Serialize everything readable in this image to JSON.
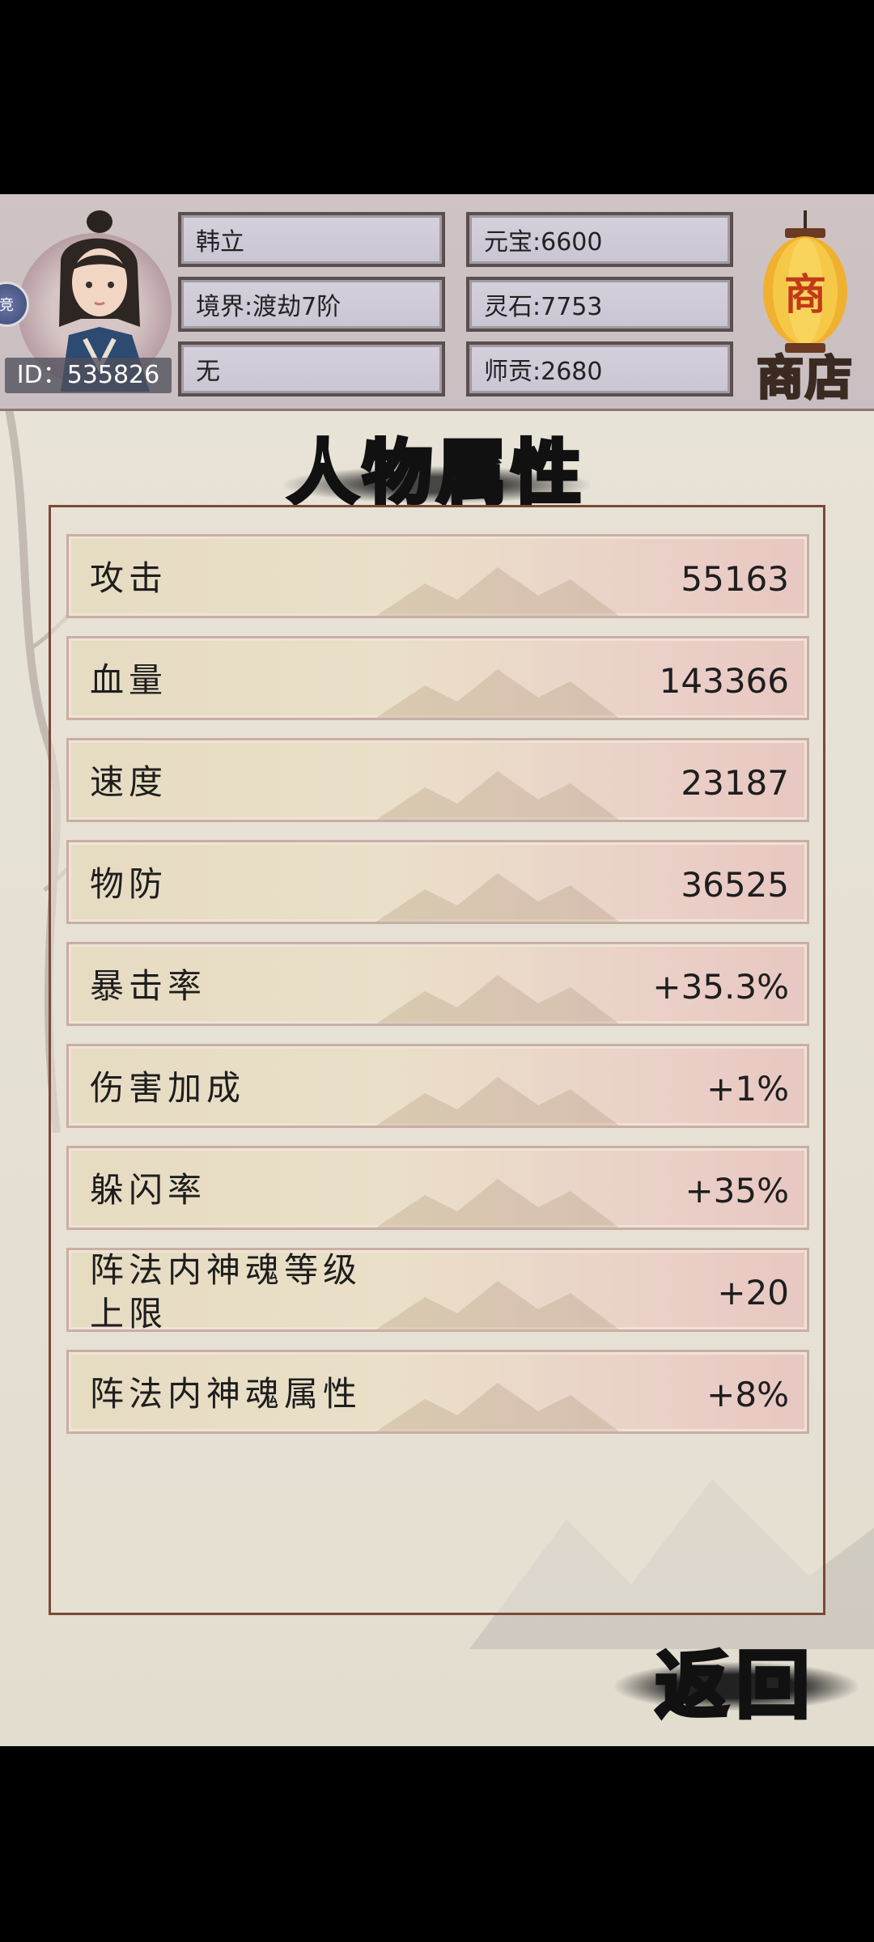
{
  "header": {
    "player_id": "ID：535826",
    "name": "韩立",
    "realm": "境界:渡劫7阶",
    "sect": "无",
    "yuanbao": "元宝:6600",
    "lingshi": "灵石:7753",
    "shigong": "师贡:2680",
    "shop_label": "商店",
    "lantern_char": "商",
    "side_orb_char": "竞"
  },
  "page_title": "人物属性",
  "stats": [
    {
      "label": "攻击",
      "value": "55163"
    },
    {
      "label": "血量",
      "value": "143366"
    },
    {
      "label": "速度",
      "value": "23187"
    },
    {
      "label": "物防",
      "value": "36525"
    },
    {
      "label": "暴击率",
      "value": "+35.3%"
    },
    {
      "label": "伤害加成",
      "value": "+1%"
    },
    {
      "label": "躲闪率",
      "value": "+35%"
    },
    {
      "label": "阵法内神魂等级上限",
      "value": "+20"
    },
    {
      "label": "阵法内神魂属性",
      "value": "+8%"
    }
  ],
  "back_label": "返回"
}
